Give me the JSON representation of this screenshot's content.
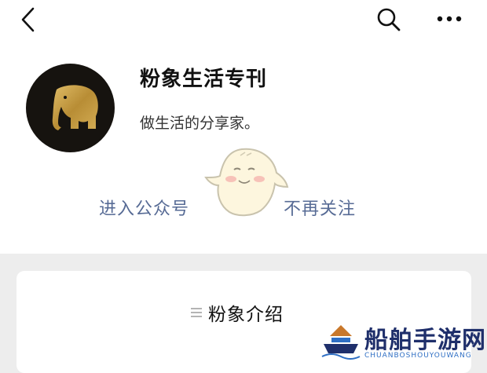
{
  "header": {
    "back_icon": "chevron-left-icon",
    "search_icon": "search-icon",
    "more_icon": "more-horizontal-icon"
  },
  "account": {
    "name": "粉象生活专刊",
    "description": "做生活的分享家。",
    "avatar_icon": "elephant-logo",
    "avatar_bg": "#16130f",
    "avatar_fg": "#c9a24a"
  },
  "actions": {
    "enter_label": "进入公众号",
    "unfollow_label": "不再关注",
    "link_color": "#576b95"
  },
  "intro": {
    "icon": "menu-lines-icon",
    "label": "粉象介绍"
  },
  "watermark": {
    "text": "船舶手游网",
    "sub": "CHUANBOSHOUYOUWANG"
  }
}
